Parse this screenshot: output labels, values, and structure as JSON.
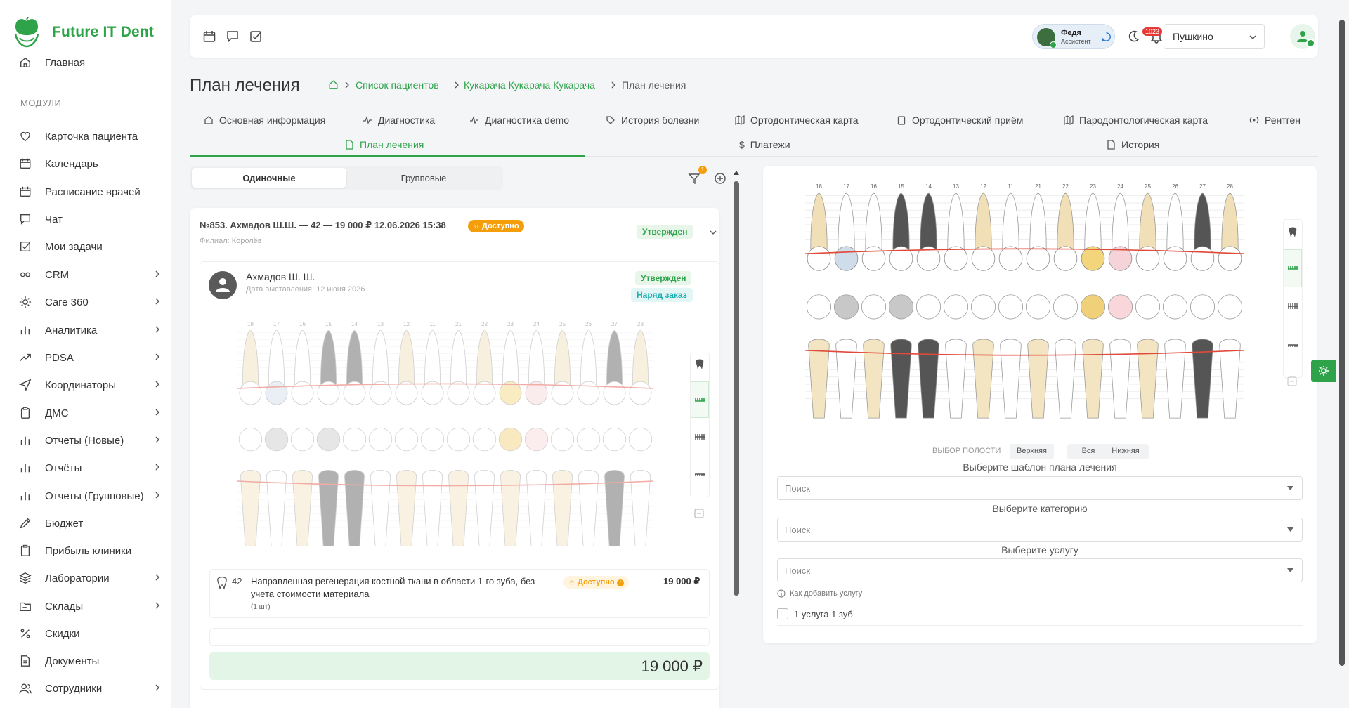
{
  "brand": {
    "name": "Future IT Dent",
    "color": "#2ea34a"
  },
  "nav": {
    "home": "Главная",
    "section": "МОДУЛИ",
    "items": [
      {
        "label": "Карточка пациента",
        "icon": "heart-icon",
        "chev": false
      },
      {
        "label": "Календарь",
        "icon": "calendar-icon",
        "chev": false
      },
      {
        "label": "Расписание врачей",
        "icon": "calendar-icon",
        "chev": false
      },
      {
        "label": "Чат",
        "icon": "chat-icon",
        "chev": false
      },
      {
        "label": "Мои задачи",
        "icon": "checkbox-icon",
        "chev": false
      },
      {
        "label": "CRM",
        "icon": "crm-icon",
        "chev": true
      },
      {
        "label": "Care 360",
        "icon": "sun-icon",
        "chev": true
      },
      {
        "label": "Аналитика",
        "icon": "bar-chart-icon",
        "chev": true
      },
      {
        "label": "PDSA",
        "icon": "trend-icon",
        "chev": true
      },
      {
        "label": "Координаторы",
        "icon": "send-icon",
        "chev": true
      },
      {
        "label": "ДМС",
        "icon": "clipboard-icon",
        "chev": true
      },
      {
        "label": "Отчеты (Новые)",
        "icon": "bar-chart-icon",
        "chev": true
      },
      {
        "label": "Отчёты",
        "icon": "bar-chart-icon",
        "chev": true
      },
      {
        "label": "Отчеты (Групповые)",
        "icon": "bar-chart-icon",
        "chev": true
      },
      {
        "label": "Бюджет",
        "icon": "pen-icon",
        "chev": false
      },
      {
        "label": "Прибыль клиники",
        "icon": "clipboard-icon",
        "chev": false
      },
      {
        "label": "Лаборатории",
        "icon": "layers-icon",
        "chev": true
      },
      {
        "label": "Склады",
        "icon": "folder-icon",
        "chev": true
      },
      {
        "label": "Скидки",
        "icon": "percent-icon",
        "chev": false
      },
      {
        "label": "Документы",
        "icon": "document-icon",
        "chev": false
      },
      {
        "label": "Сотрудники",
        "icon": "users-icon",
        "chev": true
      }
    ]
  },
  "topbar": {
    "user_name": "Федя",
    "user_role": "Ассистент",
    "notifications": "1023",
    "branch": "Пушкино"
  },
  "page": {
    "title": "План лечения",
    "breadcrumb": [
      "Список пациентов",
      "Кукарача Кукарача Кукарача",
      "План лечения"
    ]
  },
  "tabs": {
    "row1": [
      "Основная информация",
      "Диагностика",
      "Диагностика demo",
      "История болезни",
      "Ортодонтическая карта",
      "Ортодонтический приём",
      "Пародонтологическая карта",
      "Рентген"
    ],
    "row2": [
      "План лечения",
      "Платежи",
      "История"
    ],
    "active": "План лечения"
  },
  "plans": {
    "segment": [
      "Одиночные",
      "Групповые"
    ],
    "filter_count": "1",
    "card": {
      "title": "№853. Ахмадов Ш.Ш. — 42 — 19 000 ₽ 12.06.2026 15:38",
      "availability": "Доступно",
      "status": "Утвержден",
      "branch": "Филиал: Королёв",
      "patient": "Ахмадов Ш. Ш.",
      "date": "Дата выставления: 12 июня 2026",
      "status2": "Утвержден",
      "order": "Наряд заказ",
      "service": {
        "tooth": "42",
        "name": "Направленная регенерация костной ткани в области 1-го зуба, без учета стоимости материала",
        "qty": "(1 шт)",
        "availability": "Доступно",
        "price": "19 000 ₽"
      },
      "total": "19 000 ₽"
    }
  },
  "teeth": {
    "upper_numbers": [
      "18",
      "17",
      "16",
      "15",
      "14",
      "13",
      "12",
      "11",
      "21",
      "22",
      "23",
      "24",
      "25",
      "26",
      "27",
      "28"
    ]
  },
  "right": {
    "jaw_label": "ВЫБОР ПОЛОСТИ",
    "jaw_options": [
      "Верхняя",
      "Вся",
      "Нижняя"
    ],
    "template_label": "Выберите шаблон плана лечения",
    "category_label": "Выберите категорию",
    "service_label": "Выберите услугу",
    "search_placeholder": "Поиск",
    "hint": "Как добавить услугу",
    "checkbox": "1 услуга 1 зуб"
  }
}
